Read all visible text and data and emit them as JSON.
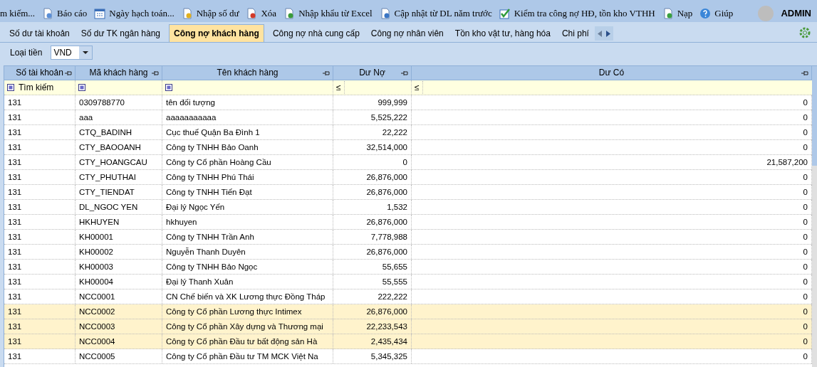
{
  "toolbar": {
    "items": [
      {
        "label": "m kiếm...",
        "kind": "search"
      },
      {
        "label": "Báo cáo",
        "kind": "report"
      },
      {
        "label": "Ngày hạch toán...",
        "kind": "calendar"
      },
      {
        "label": "Nhập số dư",
        "kind": "import"
      },
      {
        "label": "Xóa",
        "kind": "delete"
      },
      {
        "label": "Nhập khẩu từ Excel",
        "kind": "excel"
      },
      {
        "label": "Cập nhật từ DL năm trước",
        "kind": "update"
      },
      {
        "label": "Kiểm tra công nợ HĐ, tồn kho VTHH",
        "kind": "check"
      },
      {
        "label": "Nạp",
        "kind": "reload"
      },
      {
        "label": "Giúp",
        "kind": "help"
      }
    ],
    "user": "ADMIN"
  },
  "tabs": [
    {
      "label": "Số dư tài khoản",
      "selected": false
    },
    {
      "label": "Số dư TK ngân hàng",
      "selected": false
    },
    {
      "label": "Công nợ khách hàng",
      "selected": true
    },
    {
      "label": "Công nợ nhà cung cấp",
      "selected": false
    },
    {
      "label": "Công nợ nhân viên",
      "selected": false
    },
    {
      "label": "Tồn kho vật tư, hàng hóa",
      "selected": false
    },
    {
      "label": "Chi phí",
      "selected": false
    }
  ],
  "currency": {
    "label": "Loại tiền",
    "value": "VND"
  },
  "table": {
    "columns": [
      "Số tài khoản",
      "Mã khách hàng",
      "Tên khách hàng",
      "Dư Nợ",
      "Dư Có"
    ],
    "filter": {
      "placeholder": "Tìm kiếm",
      "operator_1": "≤",
      "operator_2": "≤"
    },
    "rows": [
      {
        "cells": [
          "131",
          "0309788770",
          "tên đối tượng",
          "999,999",
          "0"
        ],
        "selected": false
      },
      {
        "cells": [
          "131",
          "aaa",
          "aaaaaaaaaaa",
          "5,525,222",
          "0"
        ],
        "selected": false
      },
      {
        "cells": [
          "131",
          "CTQ_BADINH",
          "Cục thuế Quận Ba Đình 1",
          "22,222",
          "0"
        ],
        "selected": false
      },
      {
        "cells": [
          "131",
          "CTY_BAOOANH",
          "Công ty TNHH Bảo Oanh",
          "32,514,000",
          "0"
        ],
        "selected": false
      },
      {
        "cells": [
          "131",
          "CTY_HOANGCAU",
          "Công ty Cổ phần Hoàng Cầu",
          "0",
          "21,587,200"
        ],
        "selected": false
      },
      {
        "cells": [
          "131",
          "CTY_PHUTHAI",
          "Công ty TNHH Phú Thái",
          "26,876,000",
          "0"
        ],
        "selected": false
      },
      {
        "cells": [
          "131",
          "CTY_TIENDAT",
          "Công ty TNHH Tiến Đạt",
          "26,876,000",
          "0"
        ],
        "selected": false
      },
      {
        "cells": [
          "131",
          "DL_NGOC YEN",
          "Đại lý Ngọc Yến",
          "1,532",
          "0"
        ],
        "selected": false
      },
      {
        "cells": [
          "131",
          "HKHUYEN",
          "hkhuyen",
          "26,876,000",
          "0"
        ],
        "selected": false
      },
      {
        "cells": [
          "131",
          "KH00001",
          "Công ty TNHH Trần Anh",
          "7,778,988",
          "0"
        ],
        "selected": false
      },
      {
        "cells": [
          "131",
          "KH00002",
          "Nguyễn Thanh Duyên",
          "26,876,000",
          "0"
        ],
        "selected": false
      },
      {
        "cells": [
          "131",
          "KH00003",
          "Công ty TNHH Bảo Ngọc",
          "55,655",
          "0"
        ],
        "selected": false
      },
      {
        "cells": [
          "131",
          "KH00004",
          "Đại lý Thanh Xuân",
          "55,555",
          "0"
        ],
        "selected": false
      },
      {
        "cells": [
          "131",
          "NCC0001",
          "CN Chế biến và XK Lương thực Đồng Tháp",
          "222,222",
          "0"
        ],
        "selected": false
      },
      {
        "cells": [
          "131",
          "NCC0002",
          "Công ty Cổ phần Lương thực Intimex",
          "26,876,000",
          "0"
        ],
        "selected": true
      },
      {
        "cells": [
          "131",
          "NCC0003",
          "Công ty Cổ phần Xây dựng và Thương mại",
          "22,233,543",
          "0"
        ],
        "selected": true
      },
      {
        "cells": [
          "131",
          "NCC0004",
          "Công ty Cổ phần Đầu tư bất động sản Hà",
          "2,435,434",
          "0"
        ],
        "selected": true
      },
      {
        "cells": [
          "131",
          "NCC0005",
          "Công ty Cổ phần Đầu tư TM MCK Việt Na",
          "5,345,325",
          "0"
        ],
        "selected": false
      }
    ]
  }
}
